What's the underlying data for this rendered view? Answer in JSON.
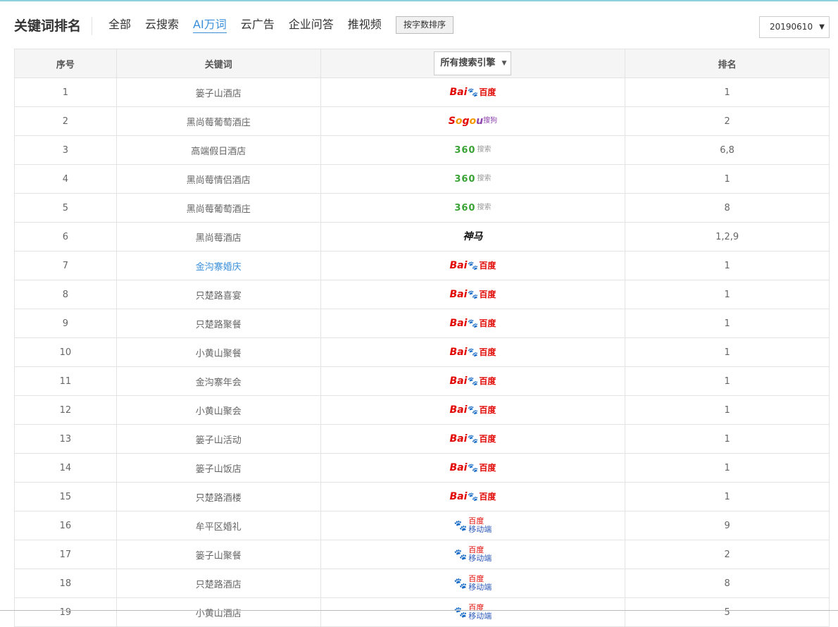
{
  "header": {
    "title": "关键词排名",
    "tabs": [
      {
        "label": "全部",
        "active": false
      },
      {
        "label": "云搜索",
        "active": false
      },
      {
        "label": "AI万词",
        "active": true
      },
      {
        "label": "云广告",
        "active": false
      },
      {
        "label": "企业问答",
        "active": false
      },
      {
        "label": "推视频",
        "active": false
      }
    ],
    "sort_label": "按字数排序",
    "date_value": "20190610",
    "accent_color": "#3b8fd9"
  },
  "table": {
    "headers": {
      "index": "序号",
      "keyword": "关键词",
      "engine": "所有搜索引擎",
      "rank": "排名"
    },
    "rows": [
      {
        "index": "1",
        "keyword": "篓子山酒店",
        "engine": "baidu",
        "rank": "1"
      },
      {
        "index": "2",
        "keyword": "黑尚莓葡萄酒庄",
        "engine": "sogou",
        "rank": "2"
      },
      {
        "index": "3",
        "keyword": "高端假日酒店",
        "engine": "360",
        "rank": "6,8"
      },
      {
        "index": "4",
        "keyword": "黑尚莓情侣酒店",
        "engine": "360",
        "rank": "1"
      },
      {
        "index": "5",
        "keyword": "黑尚莓葡萄酒庄",
        "engine": "360",
        "rank": "8"
      },
      {
        "index": "6",
        "keyword": "黑尚莓酒店",
        "engine": "shenma",
        "rank": "1,2,9"
      },
      {
        "index": "7",
        "keyword": "金沟寨婚庆",
        "engine": "baidu",
        "rank": "1",
        "link": true
      },
      {
        "index": "8",
        "keyword": "只楚路喜宴",
        "engine": "baidu",
        "rank": "1"
      },
      {
        "index": "9",
        "keyword": "只楚路聚餐",
        "engine": "baidu",
        "rank": "1"
      },
      {
        "index": "10",
        "keyword": "小黄山聚餐",
        "engine": "baidu",
        "rank": "1"
      },
      {
        "index": "11",
        "keyword": "金沟寨年会",
        "engine": "baidu",
        "rank": "1"
      },
      {
        "index": "12",
        "keyword": "小黄山聚会",
        "engine": "baidu",
        "rank": "1"
      },
      {
        "index": "13",
        "keyword": "篓子山活动",
        "engine": "baidu",
        "rank": "1"
      },
      {
        "index": "14",
        "keyword": "篓子山饭店",
        "engine": "baidu",
        "rank": "1"
      },
      {
        "index": "15",
        "keyword": "只楚路酒楼",
        "engine": "baidu",
        "rank": "1"
      },
      {
        "index": "16",
        "keyword": "牟平区婚礼",
        "engine": "baidu-mobile",
        "rank": "9"
      },
      {
        "index": "17",
        "keyword": "篓子山聚餐",
        "engine": "baidu-mobile",
        "rank": "2"
      },
      {
        "index": "18",
        "keyword": "只楚路酒店",
        "engine": "baidu-mobile",
        "rank": "8"
      },
      {
        "index": "19",
        "keyword": "小黄山酒店",
        "engine": "baidu-mobile",
        "rank": "5"
      }
    ]
  },
  "logos": {
    "baidu": {
      "prefix": "Bai",
      "paw": "🐾",
      "suffix": "百度"
    },
    "sogou": {
      "text": "Sogou",
      "suffix": "搜狗"
    },
    "360": {
      "text": "360",
      "suffix": "搜索"
    },
    "shenma": {
      "text": "神马"
    },
    "baidu-mobile": {
      "paw": "🐾",
      "line1": "百度",
      "line2": "移动端"
    }
  }
}
